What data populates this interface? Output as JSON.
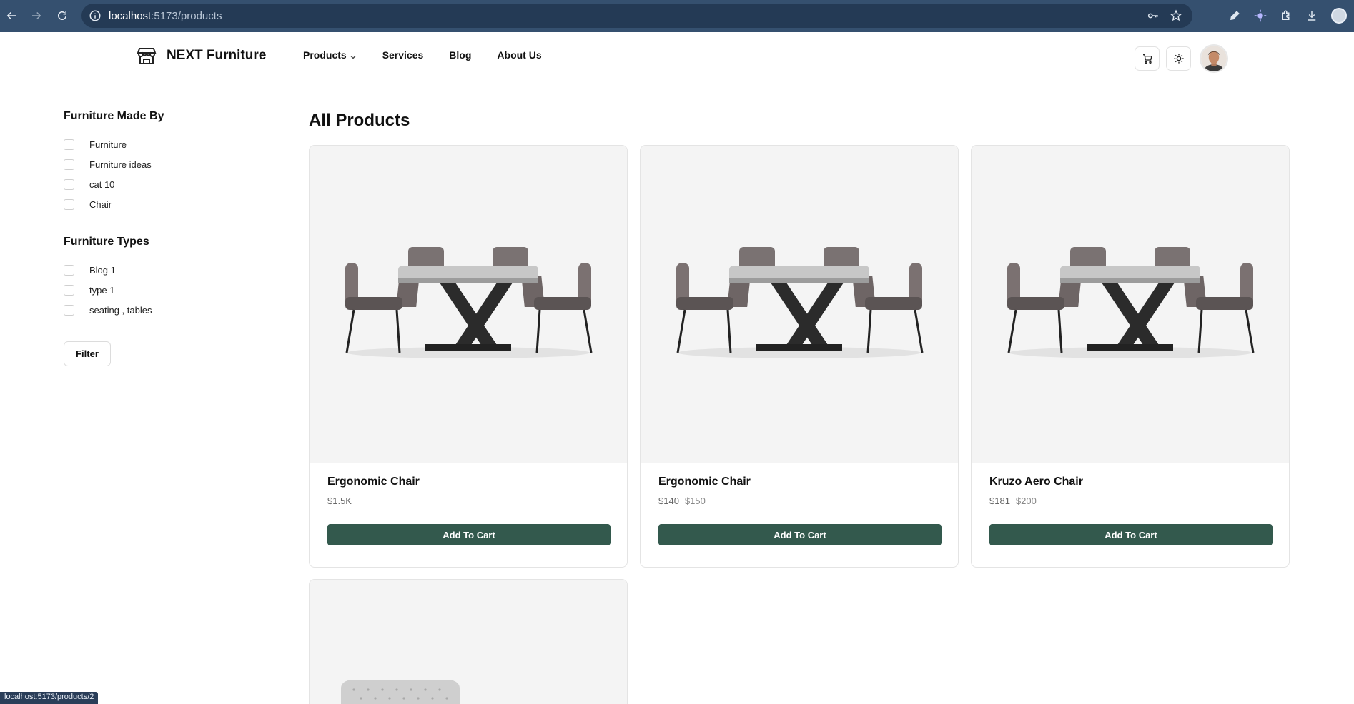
{
  "browser": {
    "url_host": "localhost",
    "url_rest": ":5173/products",
    "status_url": "localhost:5173/products/2"
  },
  "header": {
    "brand": "NEXT Furniture",
    "nav": [
      "Products",
      "Services",
      "Blog",
      "About Us"
    ]
  },
  "sidebar": {
    "made_by_title": "Furniture Made By",
    "made_by": [
      "Furniture",
      "Furniture ideas",
      "cat 10",
      "Chair"
    ],
    "types_title": "Furniture Types",
    "types": [
      "Blog 1",
      "type 1",
      "seating , tables"
    ],
    "filter_label": "Filter"
  },
  "main": {
    "title": "All Products",
    "products": [
      {
        "name": "Ergonomic Chair",
        "price": "$1.5K",
        "old_price": "",
        "button": "Add To Cart"
      },
      {
        "name": "Ergonomic Chair",
        "price": "$140",
        "old_price": "$150",
        "button": "Add To Cart"
      },
      {
        "name": "Kruzo Aero Chair",
        "price": "$181",
        "old_price": "$200",
        "button": "Add To Cart"
      }
    ]
  },
  "colors": {
    "chrome": "#35506f",
    "accent": "#33594d"
  }
}
